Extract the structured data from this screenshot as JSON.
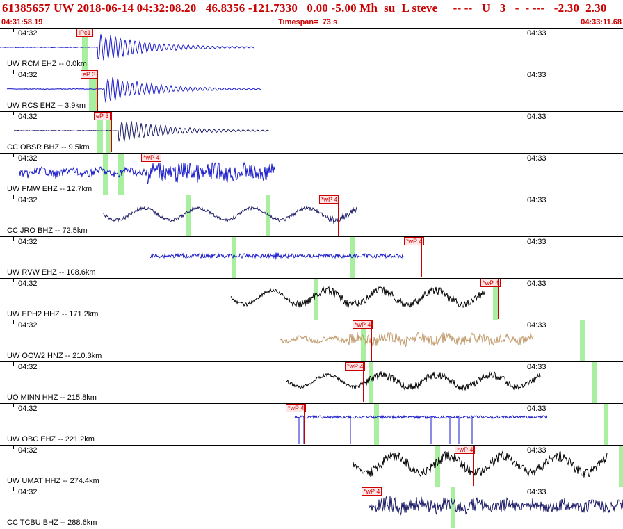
{
  "header": {
    "title": "61385657 UW 2018-06-14 04:32:08.20   46.8356 -121.7330   0.00 -5.00 Mh  su  L steve     -- --   U   3   -  - ---   -2.30  2.30",
    "start_time": "04:31:58.19",
    "timespan": "Timespan=  73 s",
    "end_time": "04:33:11.68"
  },
  "time_labels": {
    "left": "04:32",
    "right": "04:33"
  },
  "traces": [
    {
      "label": "UW RCM EHZ -- 0.0km",
      "pick": "iPc1",
      "color": "#1a1acc"
    },
    {
      "label": "UW RCS EHZ -- 3.9km",
      "pick": "eP 3",
      "color": "#1a1acc"
    },
    {
      "label": "CC OBSR BHZ -- 9.5km",
      "pick": "eP 3",
      "color": "#1a1a66"
    },
    {
      "label": "UW FMW EHZ -- 12.7km",
      "pick": "*wP 4",
      "color": "#1a1acc"
    },
    {
      "label": "CC JRO BHZ -- 72.5km",
      "pick": "*wP 4",
      "color": "#1a1a66"
    },
    {
      "label": "UW RVW EHZ -- 108.6km",
      "pick": "*wP 4",
      "color": "#1a1acc"
    },
    {
      "label": "UW EPH2 HHZ -- 171.2km",
      "pick": "*wP 4",
      "color": "#000000"
    },
    {
      "label": "UW OOW2 HNZ -- 210.3km",
      "pick": "*wP 4",
      "color": "#c09a6b"
    },
    {
      "label": "UO MINN HHZ -- 215.8km",
      "pick": "*wP 4",
      "color": "#000000"
    },
    {
      "label": "UW OBC EHZ -- 221.2km",
      "pick": "*wP 4",
      "color": "#1a1acc"
    },
    {
      "label": "UW UMAT HHZ -- 274.4km",
      "pick": "*wP 4",
      "color": "#000000"
    },
    {
      "label": "CC TCBU BHZ -- 288.6km",
      "pick": "*wP 4",
      "color": "#1a1a66"
    }
  ]
}
